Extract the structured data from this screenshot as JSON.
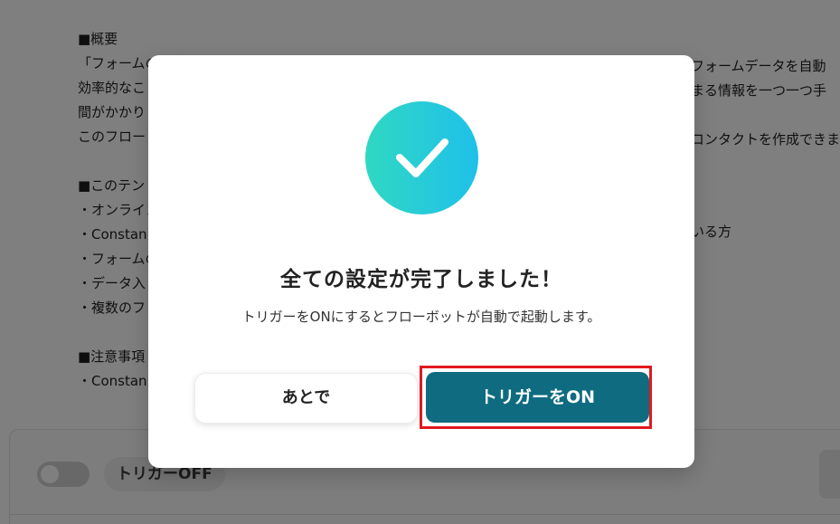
{
  "background": {
    "lines": [
      "■概要",
      "「フォームの",
      "効率的なこ",
      "間がかかり",
      "このフロー",
      "",
      "■このテン",
      "・オンライン",
      "・Constan",
      "・フォームの",
      "・データ入",
      "・複数のフ",
      "",
      "■注意事項",
      "・Constan"
    ],
    "right_fragments": {
      "line1": "フォームデータを自動",
      "line2": "まる情報を一つ一つ手",
      "line4": "コンタクトを作成できま",
      "line8": "いる方"
    }
  },
  "trigger_panel": {
    "label": "トリガーOFF"
  },
  "modal": {
    "title": "全ての設定が完了しました！",
    "description": "トリガーをONにするとフローボットが自動で起動します。",
    "later_button": "あとで",
    "on_button": "トリガーをON"
  },
  "colors": {
    "primary_button": "#0e6b80",
    "check_gradient_start": "#2fd8c2",
    "check_gradient_end": "#1fc0ea",
    "highlight": "#e0191e"
  }
}
